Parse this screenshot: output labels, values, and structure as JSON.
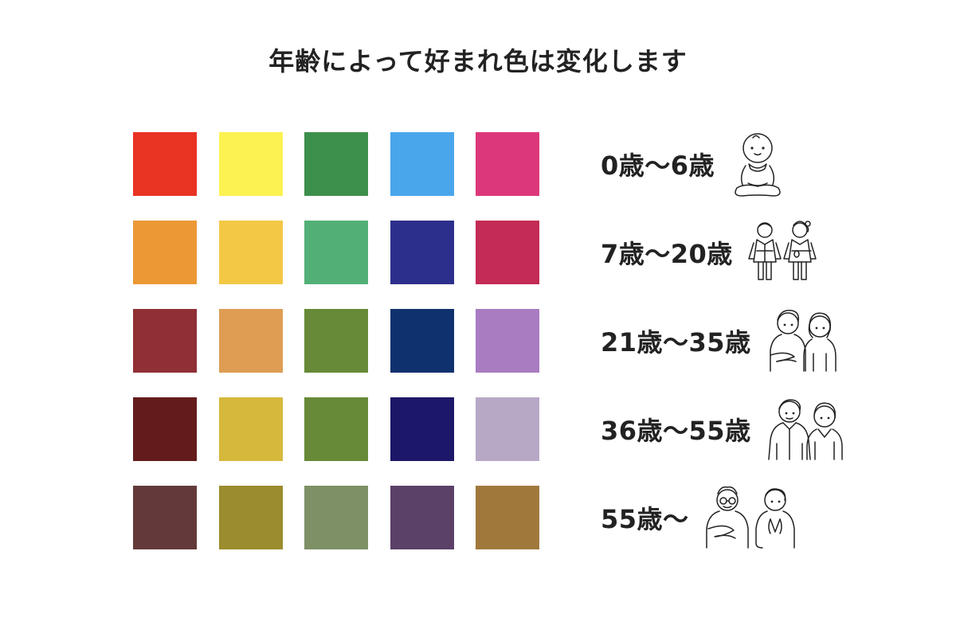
{
  "title": "年齢によって好まれ色は変化します",
  "rows": [
    {
      "age_label": "0歳〜6歳",
      "illustration": "baby-icon",
      "colors": [
        "#E93323",
        "#FCF251",
        "#3D8F4C",
        "#4AA6EB",
        "#DD377B"
      ]
    },
    {
      "age_label": "7歳〜20歳",
      "illustration": "children-kimono-icon",
      "colors": [
        "#EB9935",
        "#F3C845",
        "#52B077",
        "#2D2F8C",
        "#C42B57"
      ]
    },
    {
      "age_label": "21歳〜35歳",
      "illustration": "young-adults-icon",
      "colors": [
        "#903035",
        "#DE9D53",
        "#668A37",
        "#0F316E",
        "#A97CC2"
      ]
    },
    {
      "age_label": "36歳〜55歳",
      "illustration": "middle-aged-couple-icon",
      "colors": [
        "#631B1B",
        "#D6B83C",
        "#668A37",
        "#1C1768",
        "#B7A9C6"
      ]
    },
    {
      "age_label": "55歳〜",
      "illustration": "seniors-icon",
      "colors": [
        "#633A39",
        "#9B8C2D",
        "#7E9066",
        "#5B4067",
        "#A0783C"
      ]
    }
  ]
}
